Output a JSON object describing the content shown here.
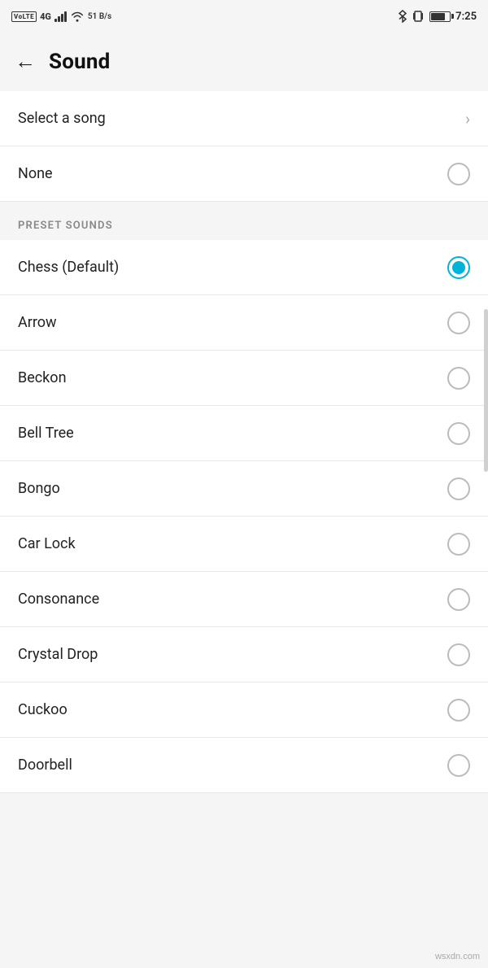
{
  "statusBar": {
    "leftItems": {
      "volte": "VoLTE",
      "signal4g": "4G",
      "wifi": "WiFi",
      "dataSpeed": "51 B/s"
    },
    "rightItems": {
      "bluetooth": "BT",
      "vibrate": "VIB",
      "battery": "75",
      "time": "7:25"
    }
  },
  "header": {
    "backLabel": "←",
    "title": "Sound"
  },
  "selectSong": {
    "label": "Select a song"
  },
  "noneOption": {
    "label": "None"
  },
  "presetSounds": {
    "sectionTitle": "PRESET SOUNDS",
    "items": [
      {
        "id": "chess",
        "label": "Chess (Default)",
        "selected": true
      },
      {
        "id": "arrow",
        "label": "Arrow",
        "selected": false
      },
      {
        "id": "beckon",
        "label": "Beckon",
        "selected": false
      },
      {
        "id": "bell-tree",
        "label": "Bell Tree",
        "selected": false
      },
      {
        "id": "bongo",
        "label": "Bongo",
        "selected": false
      },
      {
        "id": "car-lock",
        "label": "Car Lock",
        "selected": false
      },
      {
        "id": "consonance",
        "label": "Consonance",
        "selected": false
      },
      {
        "id": "crystal-drop",
        "label": "Crystal Drop",
        "selected": false
      },
      {
        "id": "cuckoo",
        "label": "Cuckoo",
        "selected": false
      },
      {
        "id": "doorbell",
        "label": "Doorbell",
        "selected": false
      }
    ]
  },
  "watermark": "wsxdn.com",
  "colors": {
    "selectedRadio": "#00b4d8",
    "divider": "#e8e8e8",
    "sectionBg": "#f5f5f5"
  }
}
